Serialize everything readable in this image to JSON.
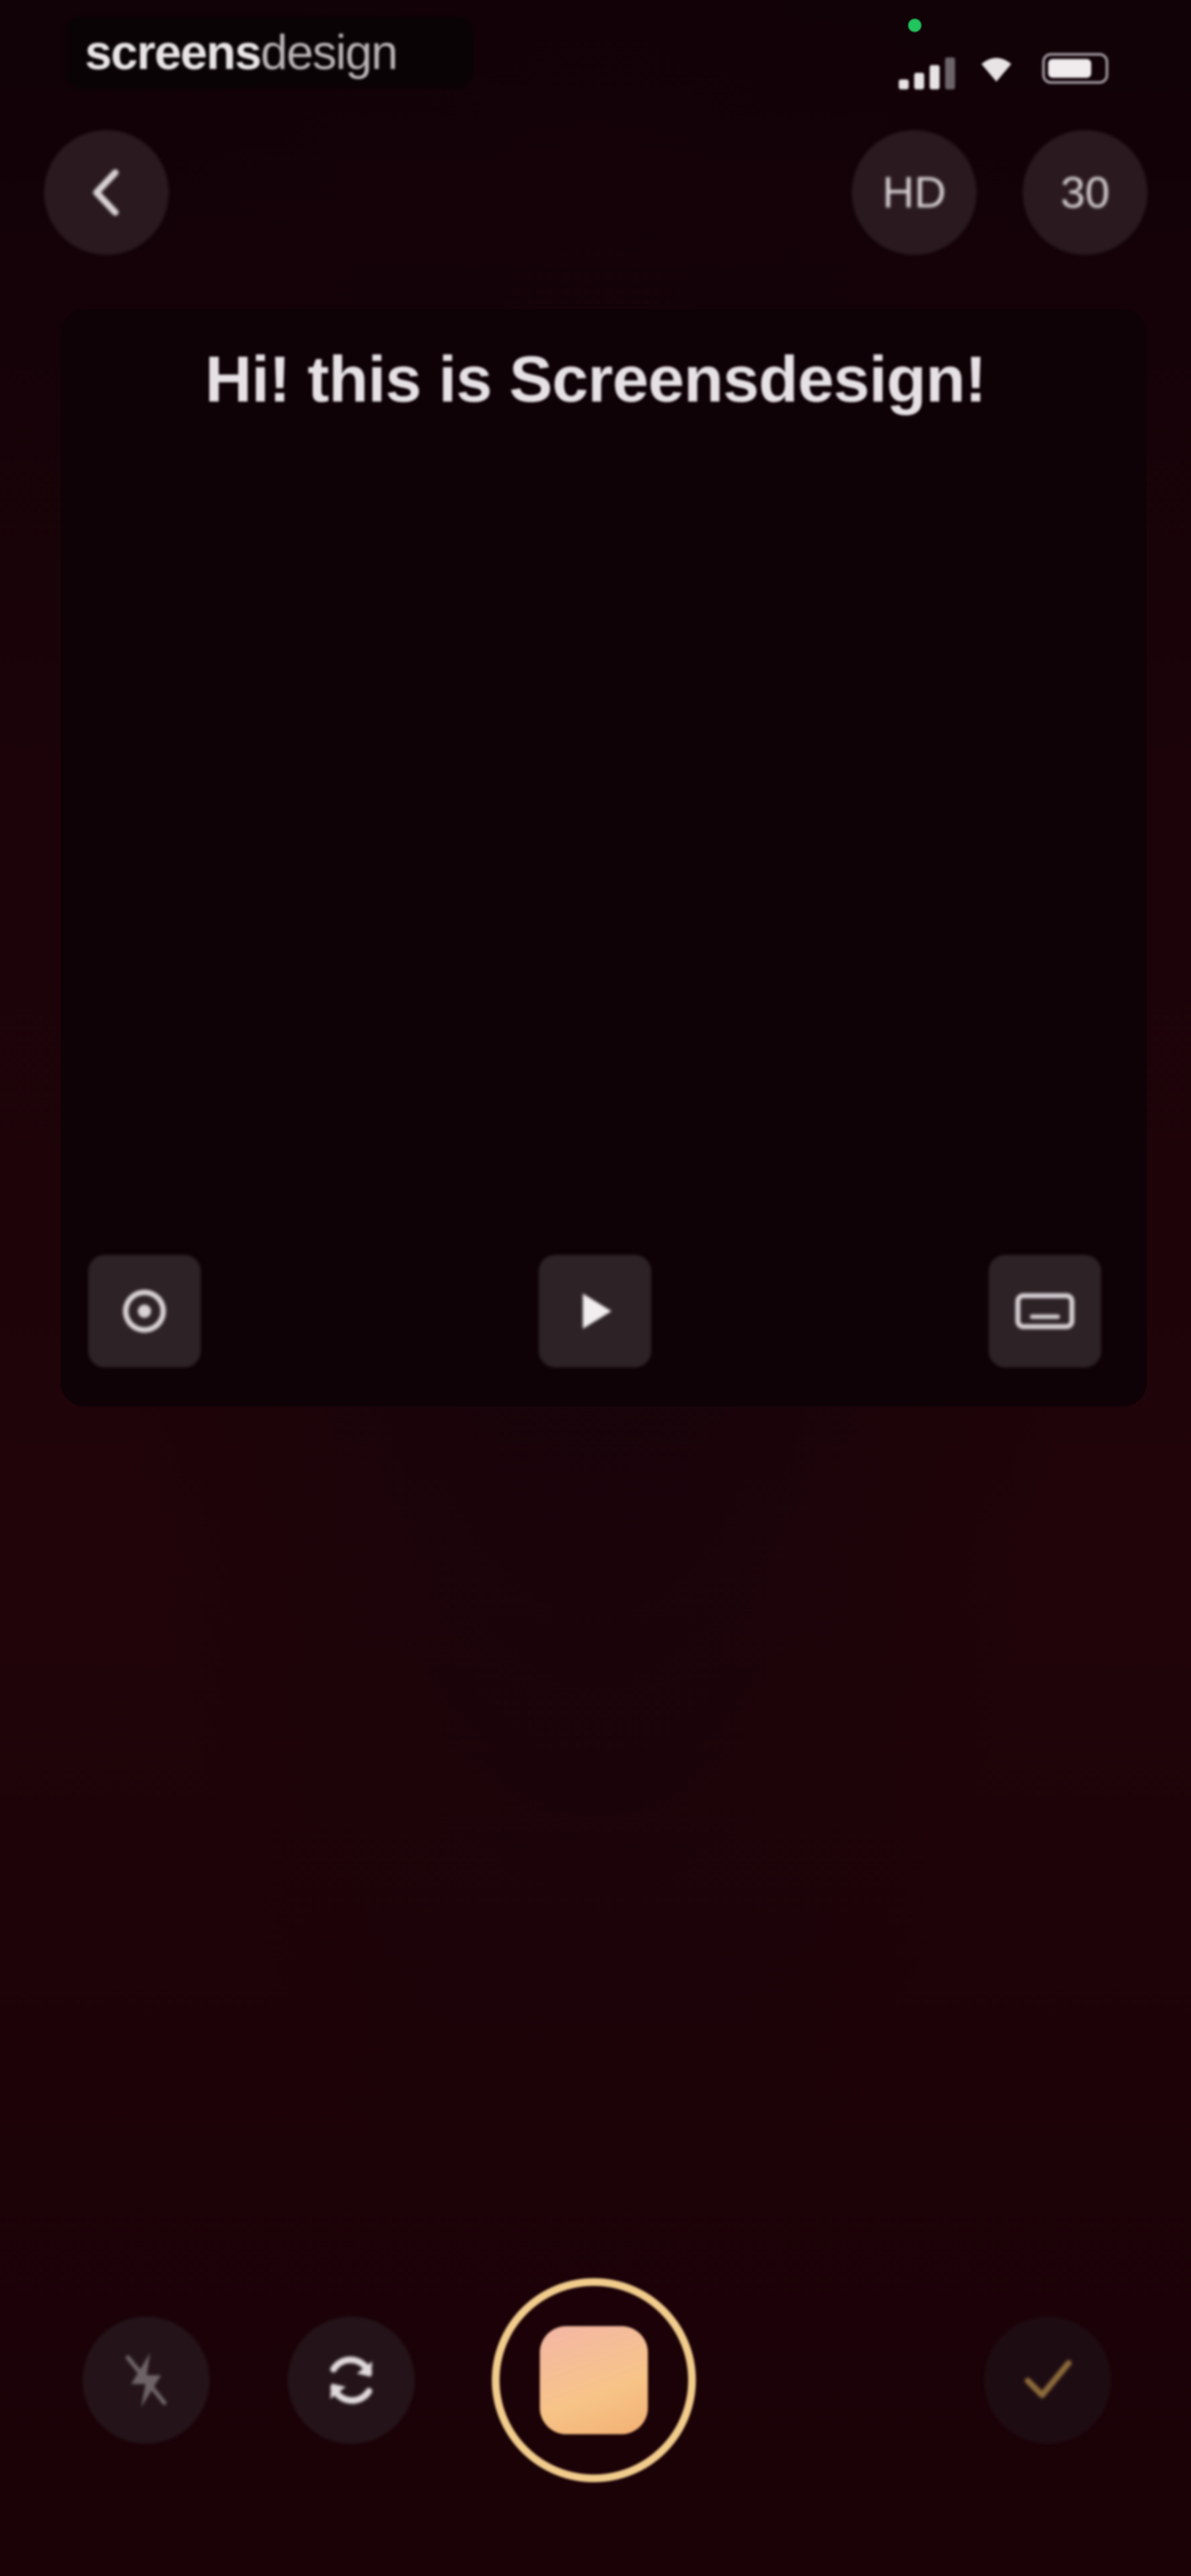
{
  "status_bar": {
    "brand_bold": "screens",
    "brand_light": "design"
  },
  "header": {
    "hd_label": "HD",
    "fps_label": "30"
  },
  "prompter": {
    "text": "Hi! this is Screensdesign!"
  },
  "icons": {
    "back": "chevron-left-icon",
    "settings": "settings-icon",
    "play": "play-icon",
    "keyboard": "keyboard-icon",
    "flash": "flash-off-icon",
    "flip": "camera-flip-icon",
    "record": "record-icon",
    "done": "checkmark-icon"
  },
  "colors": {
    "background": "#1b0309",
    "record_ring": "#f1cc8c",
    "record_fill": "#f7c488",
    "check": "#8a6a3a",
    "camera_dot": "#22c55e"
  }
}
